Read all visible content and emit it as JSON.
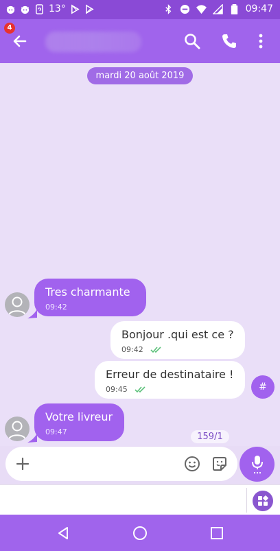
{
  "status_bar": {
    "temperature": "13°",
    "time": "09:47",
    "left_icons": [
      "cat-notification-icon",
      "cat-notification-icon",
      "phone-sync-icon",
      "play-store-icon",
      "play-store-icon"
    ],
    "right_icons": [
      "bluetooth-icon",
      "do-not-disturb-icon",
      "wifi-icon",
      "signal-icon",
      "battery-icon"
    ]
  },
  "app_bar": {
    "back_badge": "4",
    "icons": [
      "back-arrow-icon",
      "search-icon",
      "phone-icon",
      "more-vert-icon"
    ]
  },
  "chat": {
    "date_label": "mardi 20 août 2019",
    "messages": [
      {
        "direction": "incoming",
        "text": "Tres charmante",
        "time": "09:42"
      },
      {
        "direction": "outgoing",
        "text": "Bonjour .qui est ce ?",
        "time": "09:42",
        "status_icon": "double-check-icon"
      },
      {
        "direction": "outgoing",
        "text": "Erreur de destinataire !",
        "time": "09:45",
        "status_icon": "double-check-icon"
      },
      {
        "direction": "incoming",
        "text": "Votre livreur",
        "time": "09:47"
      }
    ],
    "hash_button": "#",
    "sms_counter": "159/1"
  },
  "composer": {
    "placeholder": "",
    "icons": [
      "plus-icon",
      "emoji-icon",
      "sticker-icon",
      "microphone-icon"
    ]
  },
  "extensions": {
    "icon": "extensions-grid-icon"
  },
  "nav_bar": {
    "icons": [
      "nav-back-icon",
      "nav-home-icon",
      "nav-recents-icon"
    ]
  },
  "colors": {
    "primary": "#a064ec",
    "status_bar": "#8a4ad6",
    "chat_background": "#eadff8",
    "incoming_bubble": "#a162ee",
    "outgoing_bubble": "#ffffff",
    "read_check": "#5cc17a",
    "badge": "#e8322f"
  }
}
